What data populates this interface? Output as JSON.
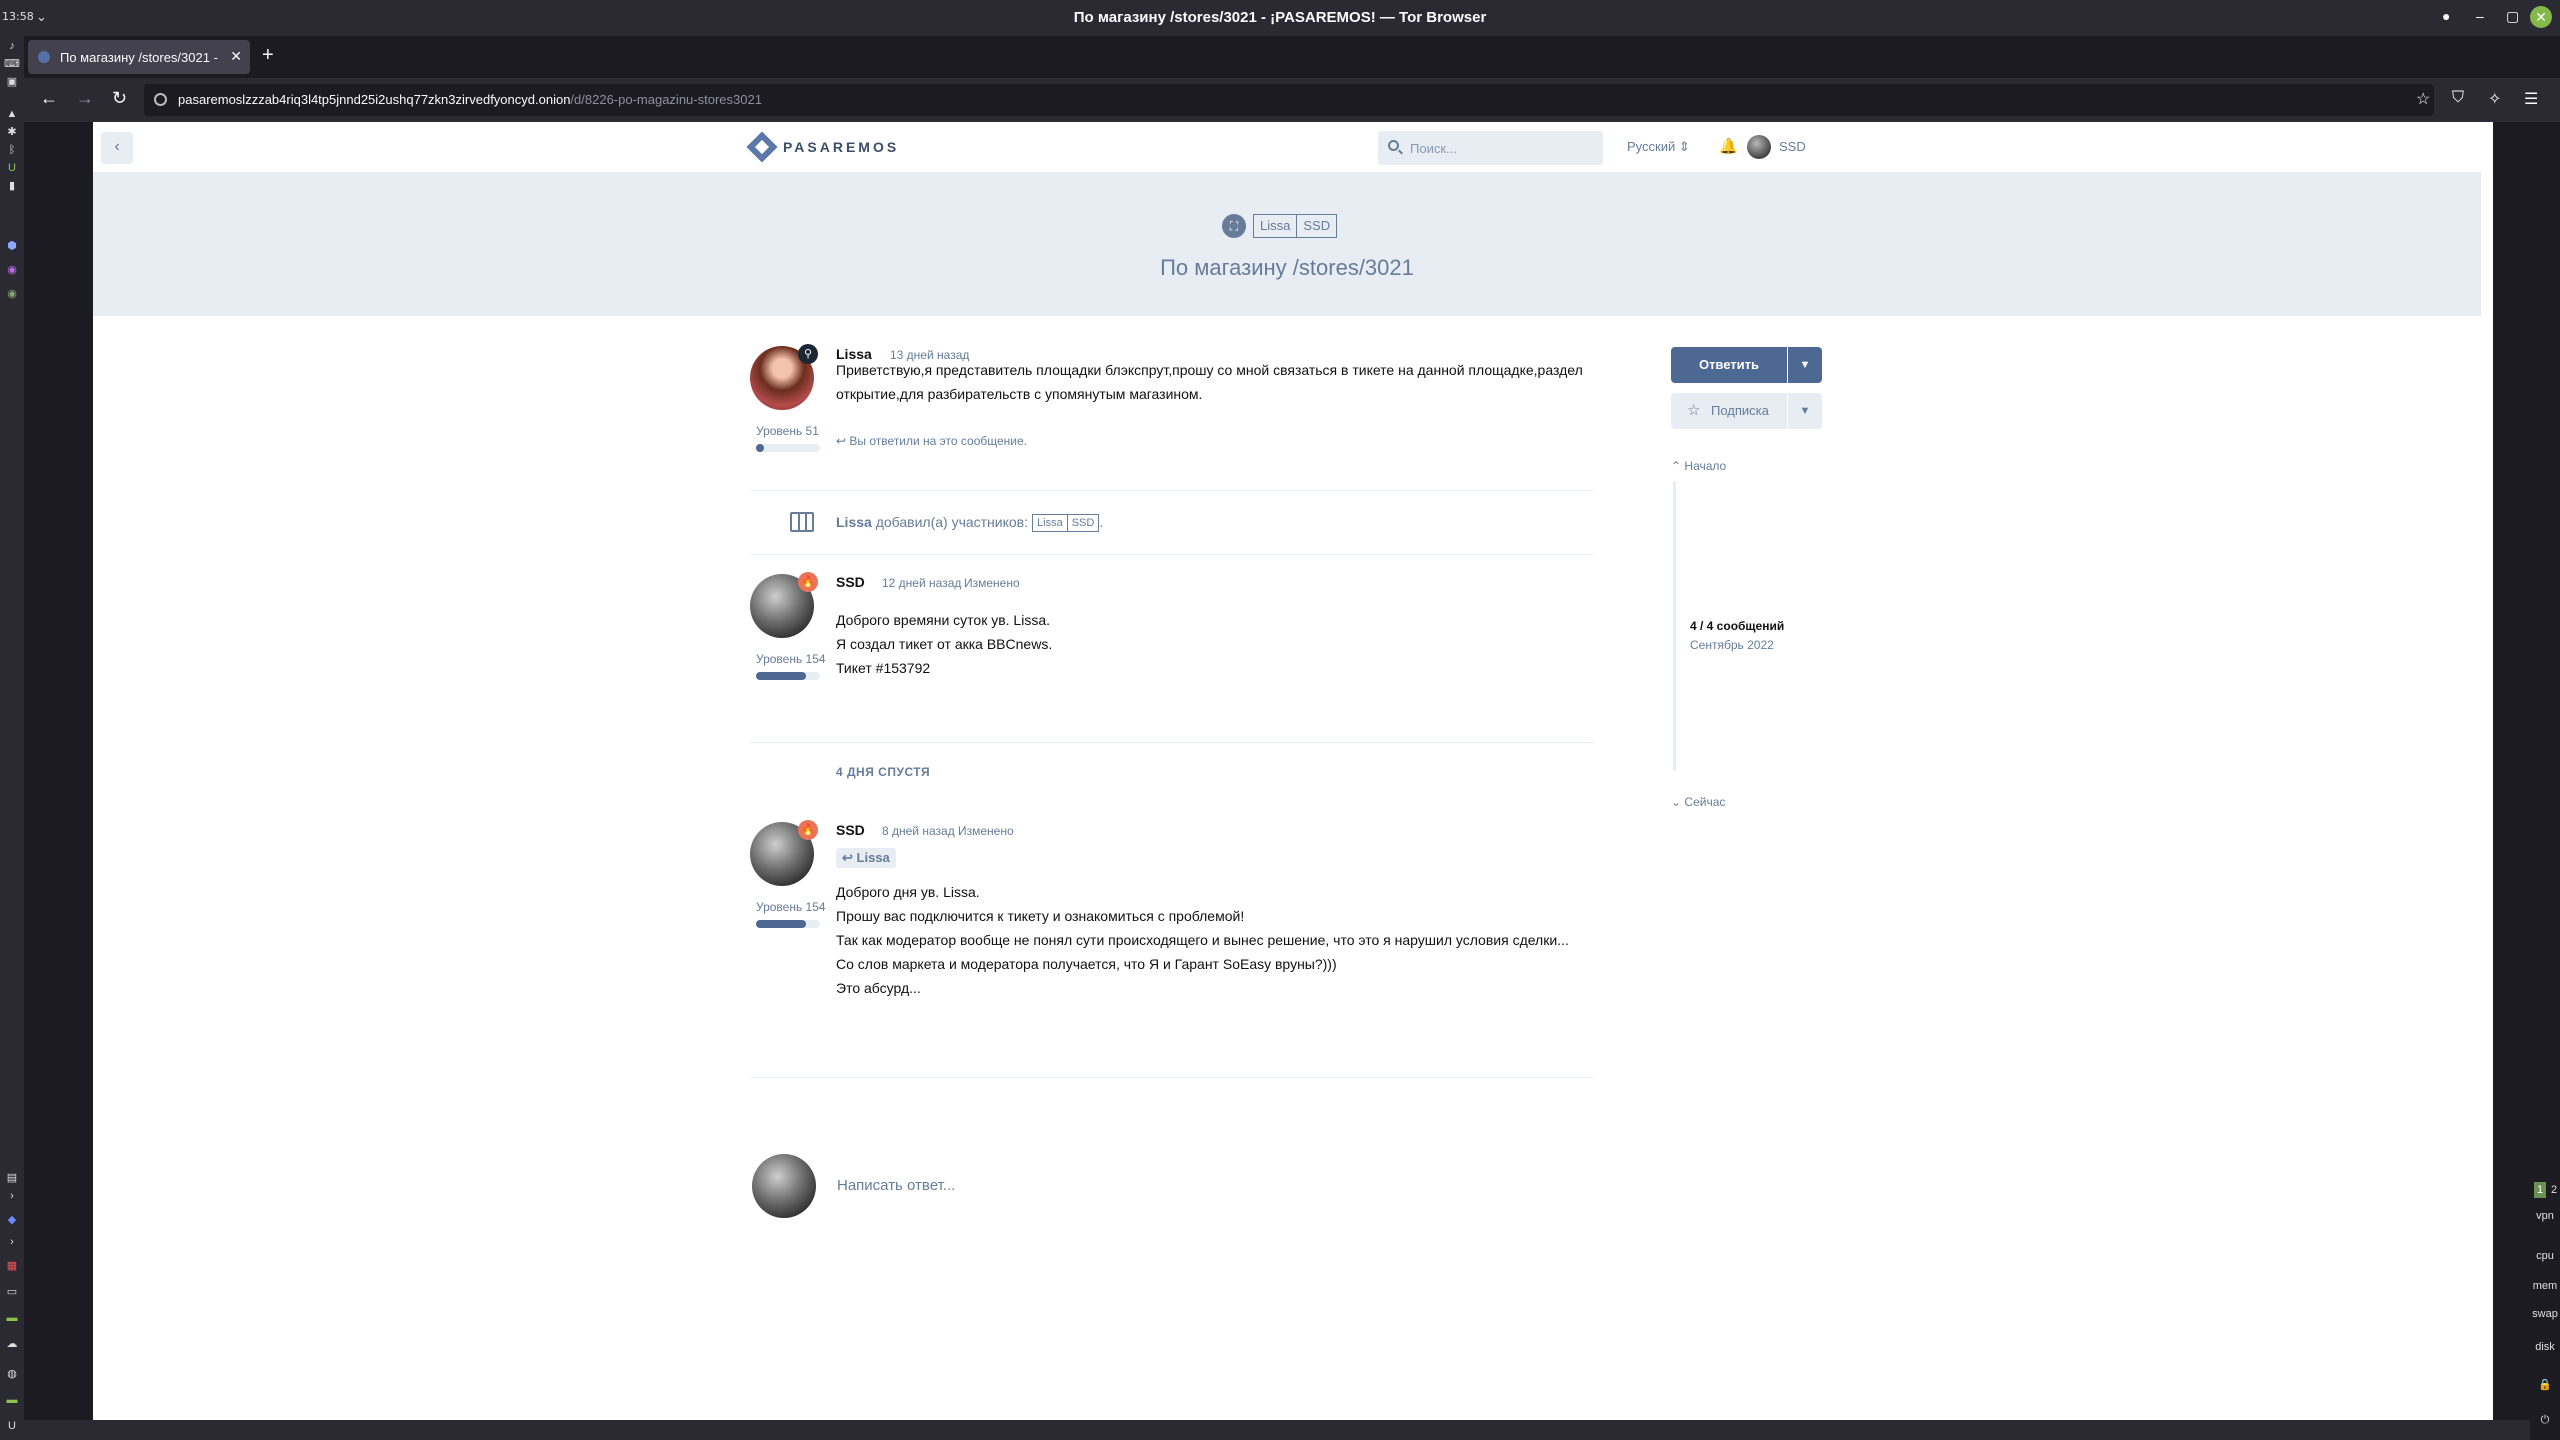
{
  "desktop": {
    "clock": "13:58",
    "window_title": "По магазину /stores/3021 - ¡PASAREMOS! — Tor Browser",
    "workspaces": [
      "1",
      "2"
    ],
    "tray_labels": [
      "vpn",
      "cpu",
      "mem",
      "swap",
      "disk"
    ]
  },
  "browser": {
    "tab_title": "По магазину /stores/3021 - ¡PASAREMOS!",
    "url_host": "pasaremoslzzzab4riq3l4tp5jnnd25i2ushq77zkn3zirvedfyoncyd.onion",
    "url_path": "/d/8226-po-magazinu-stores3021"
  },
  "site": {
    "logo_text": "PASAREMOS",
    "search_placeholder": "Поиск...",
    "language": "Русский",
    "user_name": "SSD"
  },
  "discussion": {
    "tags": [
      "Lissa",
      "SSD"
    ],
    "title": "По магазину /stores/3021"
  },
  "posts": [
    {
      "author": "Lissa",
      "time": "13 дней назад",
      "level": "Уровень 51",
      "level_fraction": 0.12,
      "body": [
        "Приветствую,я представитель площадки блэкспрут,прошу со мной связаться в тикете на данной площадке,раздел",
        "открытие,для разбирательств с упомянутым магазином."
      ],
      "replied_note": "Вы ответили на это сообщение."
    },
    {
      "author": "SSD",
      "time": "12 дней назад",
      "edited": "Изменено",
      "level": "Уровень 154",
      "level_fraction": 0.78,
      "body": [
        "Доброго времяни суток ув. Lissa.",
        "Я создал тикет от акка BBCnews.",
        "Тикет #153792"
      ]
    },
    {
      "author": "SSD",
      "time": "8 дней назад",
      "edited": "Изменено",
      "level": "Уровень 154",
      "level_fraction": 0.78,
      "reply_to": "Lissa",
      "body": [
        "Доброго дня ув. Lissa.",
        "Прошу вас подключится к тикету и ознакомиться с проблемой!",
        "Так как модератор вообще не понял сути происходящего и вынес решение, что это я нарушил условия сделки...",
        "Со слов маркета и модератора получается, что Я и Гарант SoEasy вруны?)))",
        "Это абсурд..."
      ]
    }
  ],
  "event": {
    "actor": "Lissa",
    "action": "добавил(а) участников:",
    "tags": [
      "Lissa",
      "SSD"
    ],
    "suffix": "."
  },
  "gap_label": "4 ДНЯ СПУСТЯ",
  "composer_placeholder": "Написать ответ...",
  "sidebar": {
    "reply_label": "Ответить",
    "subscribe_label": "Подписка",
    "start_label": "Начало",
    "count": "4 / 4 сообщений",
    "date": "Сентябрь 2022",
    "end_label": "Сейчас"
  }
}
